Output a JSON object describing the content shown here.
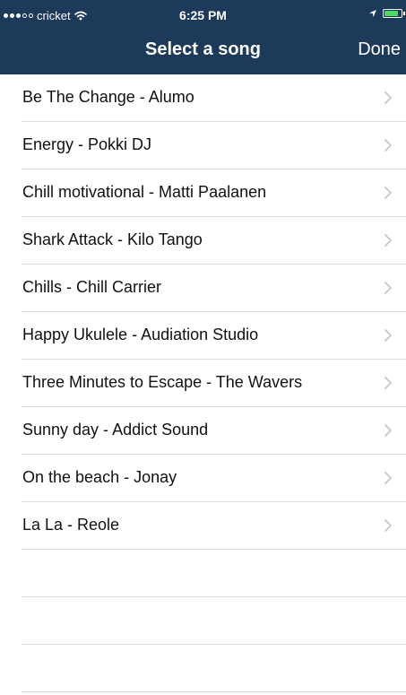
{
  "status_bar": {
    "carrier": "cricket",
    "time": "6:25 PM",
    "signal_filled": 3,
    "signal_total": 5,
    "battery_level": 0.85
  },
  "nav": {
    "title": "Select a song",
    "done_label": "Done"
  },
  "songs": [
    {
      "label": "Be The Change - Alumo"
    },
    {
      "label": "Energy - Pokki DJ"
    },
    {
      "label": "Chill motivational - Matti Paalanen"
    },
    {
      "label": "Shark Attack - Kilo Tango"
    },
    {
      "label": "Chills - Chill Carrier"
    },
    {
      "label": "Happy Ukulele - Audiation Studio"
    },
    {
      "label": "Three Minutes to Escape - The Wavers"
    },
    {
      "label": "Sunny day - Addict Sound"
    },
    {
      "label": "On the beach - Jonay"
    },
    {
      "label": "La La - Reole"
    }
  ],
  "colors": {
    "nav_bar": "#1e3a5b",
    "separator": "#dcdcdc",
    "chevron": "#c7c7cc",
    "battery": "#4cd964"
  }
}
